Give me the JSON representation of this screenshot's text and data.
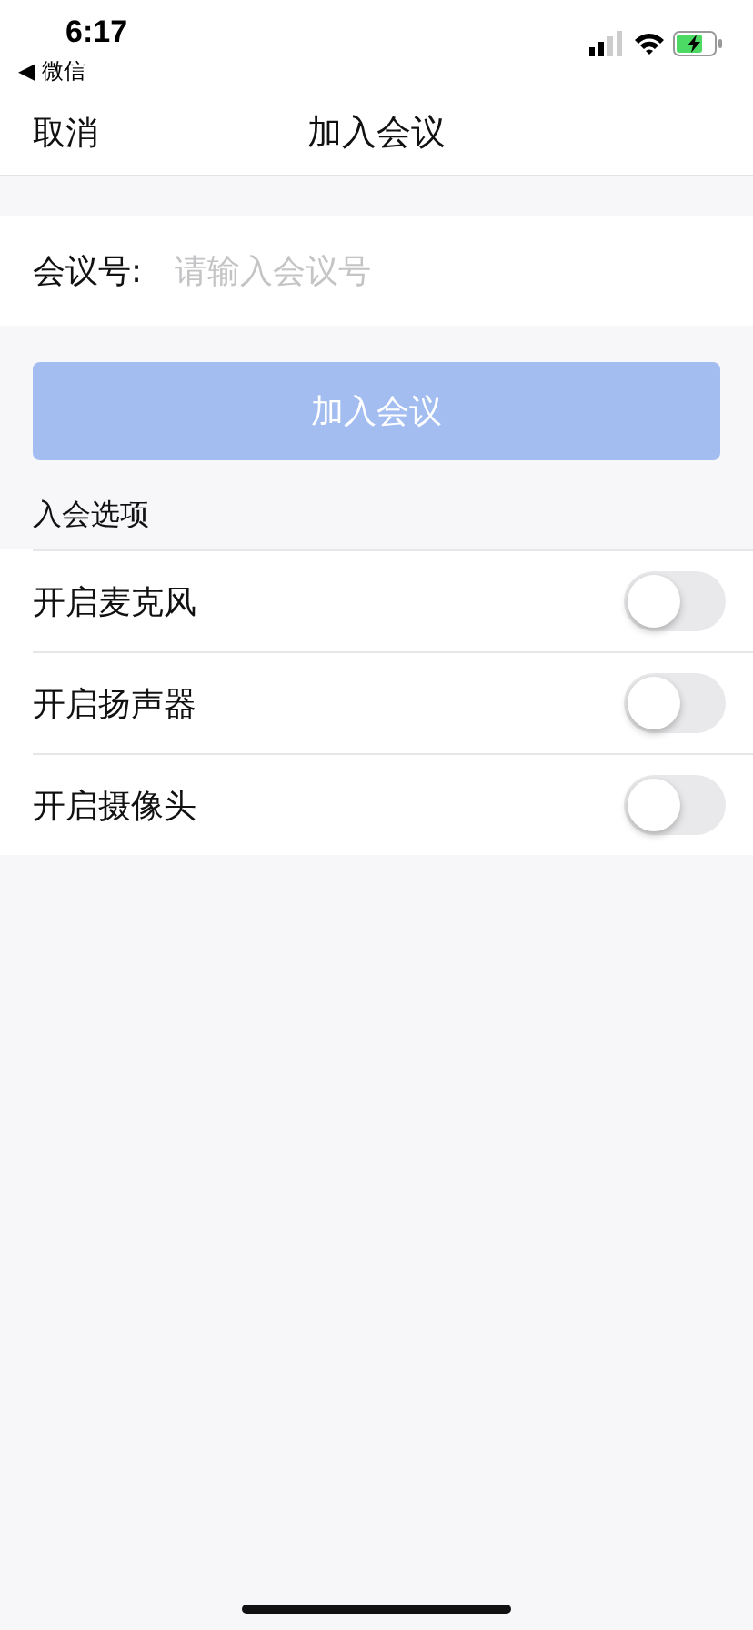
{
  "status_bar": {
    "time": "6:17",
    "back_label": "◀ 微信"
  },
  "nav_bar": {
    "left_button": "取消",
    "title": "加入会议"
  },
  "meeting_number": {
    "label": "会议号:",
    "placeholder": "请输入会议号"
  },
  "join_button": {
    "label": "加入会议",
    "disabled": true
  },
  "options_heading": "入会选项",
  "options": [
    {
      "label": "开启麦克风",
      "on": false
    },
    {
      "label": "开启扬声器",
      "on": false
    },
    {
      "label": "开启摄像头",
      "on": false
    }
  ]
}
